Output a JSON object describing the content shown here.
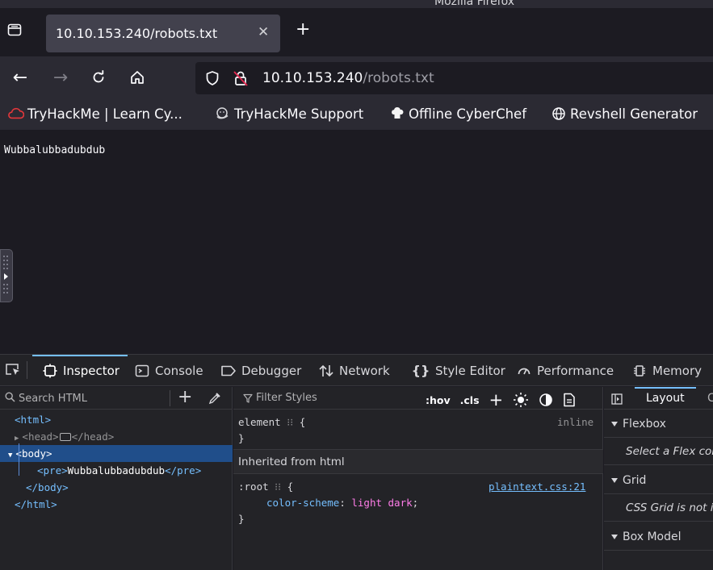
{
  "window": {
    "title": "Mozilla Firefox"
  },
  "tabs": [
    {
      "title": "10.10.153.240/robots.txt"
    }
  ],
  "address": {
    "host": "10.10.153.240",
    "path": "/robots.txt"
  },
  "bookmarks": [
    {
      "label": "TryHackMe | Learn Cy...",
      "icon": "tryhackme-icon"
    },
    {
      "label": "TryHackMe Support",
      "icon": "support-icon"
    },
    {
      "label": "Offline CyberChef",
      "icon": "chef-icon"
    },
    {
      "label": "Revshell Generator",
      "icon": "globe-icon"
    }
  ],
  "page": {
    "text": "Wubbalubbadubdub"
  },
  "devtools": {
    "tabs": [
      {
        "label": "Inspector",
        "icon": "inspector-icon",
        "selected": true
      },
      {
        "label": "Console",
        "icon": "console-icon"
      },
      {
        "label": "Debugger",
        "icon": "debugger-icon"
      },
      {
        "label": "Network",
        "icon": "network-icon"
      },
      {
        "label": "Style Editor",
        "icon": "style-editor-icon"
      },
      {
        "label": "Performance",
        "icon": "performance-icon"
      },
      {
        "label": "Memory",
        "icon": "memory-icon"
      }
    ],
    "inspector": {
      "search_placeholder": "Search HTML",
      "tree": {
        "html_open": "<html>",
        "head_open": "<head>",
        "head_close": "</head>",
        "body_open": "<body>",
        "pre_open": "<pre>",
        "pre_text": "Wubbalubbadubdub",
        "pre_close": "</pre>",
        "body_close": "</body>",
        "html_close": "</html>"
      }
    },
    "rules": {
      "filter_placeholder": "Filter Styles",
      "hov_label": ":hov",
      "cls_label": ".cls",
      "element_selector": "element",
      "element_source": "inline",
      "inherited_label": "Inherited from html",
      "root_selector": ":root",
      "root_source": "plaintext.css:21",
      "property_name": "color-scheme",
      "property_value": "light dark"
    },
    "layout": {
      "tab_layout": "Layout",
      "tab_next": "C",
      "flexbox_label": "Flexbox",
      "flexbox_note": "Select a Flex container",
      "grid_label": "Grid",
      "grid_note": "CSS Grid is not in use",
      "boxmodel_label": "Box Model"
    }
  },
  "colors": {
    "accent": "#75bfff",
    "selection": "#204e8a",
    "property_value": "#ff7de9",
    "tryhackme_red": "#e2373b"
  }
}
